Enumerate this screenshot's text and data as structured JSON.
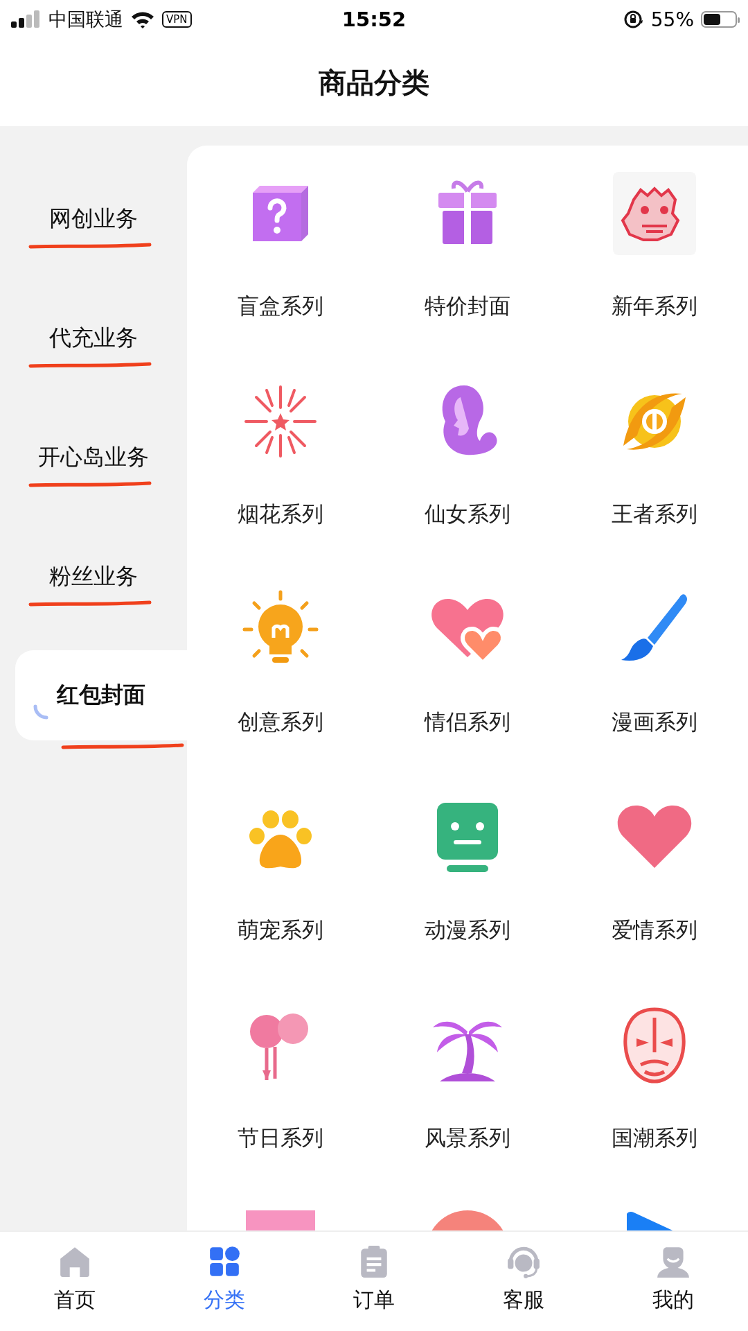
{
  "status_bar": {
    "carrier": "中国联通",
    "vpn": "VPN",
    "time": "15:52",
    "battery": "55%"
  },
  "header": {
    "title": "商品分类"
  },
  "sidebar": {
    "items": [
      {
        "label": "网创业务",
        "selected": false,
        "underlined": true
      },
      {
        "label": "代充业务",
        "selected": false,
        "underlined": true
      },
      {
        "label": "开心岛业务",
        "selected": false,
        "underlined": true
      },
      {
        "label": "粉丝业务",
        "selected": false,
        "underlined": true
      },
      {
        "label": "红包封面",
        "selected": true,
        "underlined": true
      }
    ]
  },
  "categories": [
    {
      "label": "盲盒系列"
    },
    {
      "label": "特价封面"
    },
    {
      "label": "新年系列"
    },
    {
      "label": "烟花系列"
    },
    {
      "label": "仙女系列"
    },
    {
      "label": "王者系列"
    },
    {
      "label": "创意系列"
    },
    {
      "label": "情侣系列"
    },
    {
      "label": "漫画系列"
    },
    {
      "label": "萌宠系列"
    },
    {
      "label": "动漫系列"
    },
    {
      "label": "爱情系列"
    },
    {
      "label": "节日系列"
    },
    {
      "label": "风景系列"
    },
    {
      "label": "国潮系列"
    }
  ],
  "tab_bar": {
    "items": [
      {
        "label": "首页",
        "selected": false
      },
      {
        "label": "分类",
        "selected": true
      },
      {
        "label": "订单",
        "selected": false
      },
      {
        "label": "客服",
        "selected": false
      },
      {
        "label": "我的",
        "selected": false
      }
    ]
  }
}
